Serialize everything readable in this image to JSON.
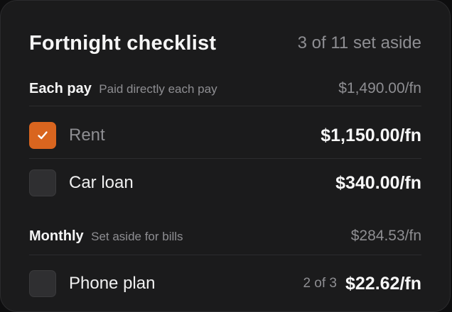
{
  "card": {
    "title": "Fortnight checklist",
    "progress": "3 of 11 set aside"
  },
  "sections": [
    {
      "name": "Each pay",
      "subtitle": "Paid directly each pay",
      "total": "$1,490.00/fn",
      "items": [
        {
          "label": "Rent",
          "amount": "$1,150.00/fn",
          "checked": true
        },
        {
          "label": "Car loan",
          "amount": "$340.00/fn",
          "checked": false
        }
      ]
    },
    {
      "name": "Monthly",
      "subtitle": "Set aside for bills",
      "total": "$284.53/fn",
      "items": [
        {
          "label": "Phone plan",
          "count": "2 of 3",
          "amount": "$22.62/fn",
          "checked": false
        }
      ]
    }
  ],
  "colors": {
    "accent": "#d9651f",
    "card_background": "#1b1b1c",
    "muted_text": "#8e8e92"
  },
  "icons": {
    "checked": "checkmark-icon"
  }
}
